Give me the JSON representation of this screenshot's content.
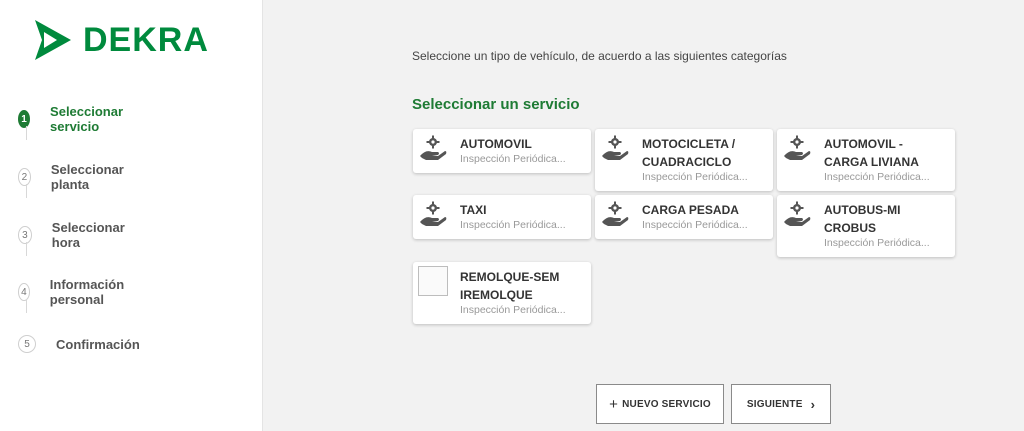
{
  "brand": {
    "name": "DEKRA",
    "color": "#008a3d"
  },
  "sidebar": {
    "steps": [
      {
        "num": "1",
        "label": "Seleccionar servicio"
      },
      {
        "num": "2",
        "label": "Seleccionar planta"
      },
      {
        "num": "3",
        "label": "Seleccionar hora"
      },
      {
        "num": "4",
        "label": "Información personal"
      },
      {
        "num": "5",
        "label": "Confirmación"
      }
    ]
  },
  "main": {
    "instruction": "Seleccione un tipo de vehículo, de acuerdo a las siguientes categorías",
    "title": "Seleccionar un servicio",
    "cards": [
      {
        "title": "AUTOMOVIL",
        "subtitle": "Inspección Periódica...",
        "icon": "hand-gear-icon"
      },
      {
        "title": "MOTOCICLETA / CUADRACICLO",
        "subtitle": "Inspección Periódica...",
        "icon": "hand-gear-icon"
      },
      {
        "title": "AUTOMOVIL - CARGA LIVIANA",
        "subtitle": "Inspección Periódica...",
        "icon": "hand-gear-icon"
      },
      {
        "title": "TAXI",
        "subtitle": "Inspección Periódica...",
        "icon": "hand-gear-icon"
      },
      {
        "title": "CARGA PESADA",
        "subtitle": "Inspección Periódica...",
        "icon": "hand-gear-icon"
      },
      {
        "title": "AUTOBUS-MICROBUS",
        "subtitle": "Inspección Periódica...",
        "icon": "hand-gear-icon"
      },
      {
        "title": "REMOLQUE-SEMIREMOLQUE",
        "subtitle": "Inspección Periódica...",
        "icon": "broken-image-icon"
      }
    ]
  },
  "actions": {
    "new_service": "NUEVO SERVICIO",
    "next": "SIGUIENTE"
  },
  "colors": {
    "accent": "#1e7b34"
  }
}
